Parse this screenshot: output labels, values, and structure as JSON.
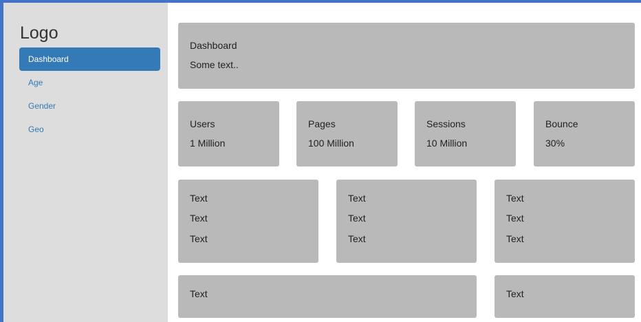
{
  "sidebar": {
    "logo": "Logo",
    "items": [
      {
        "label": "Dashboard",
        "active": true
      },
      {
        "label": "Age",
        "active": false
      },
      {
        "label": "Gender",
        "active": false
      },
      {
        "label": "Geo",
        "active": false
      }
    ]
  },
  "header_card": {
    "title": "Dashboard",
    "text": "Some text.."
  },
  "stats": [
    {
      "label": "Users",
      "value": "1 Million"
    },
    {
      "label": "Pages",
      "value": "100 Million"
    },
    {
      "label": "Sessions",
      "value": "10 Million"
    },
    {
      "label": "Bounce",
      "value": "30%"
    }
  ],
  "text_cards": [
    {
      "lines": [
        "Text",
        "Text",
        "Text"
      ]
    },
    {
      "lines": [
        "Text",
        "Text",
        "Text"
      ]
    },
    {
      "lines": [
        "Text",
        "Text",
        "Text"
      ]
    }
  ],
  "bottom_cards": [
    {
      "text": "Text"
    },
    {
      "text": "Text"
    }
  ],
  "colors": {
    "frame_border": "#4472c4",
    "sidebar_bg": "#dddddd",
    "accent": "#337ab7",
    "card_bg": "#b9b9b9"
  }
}
